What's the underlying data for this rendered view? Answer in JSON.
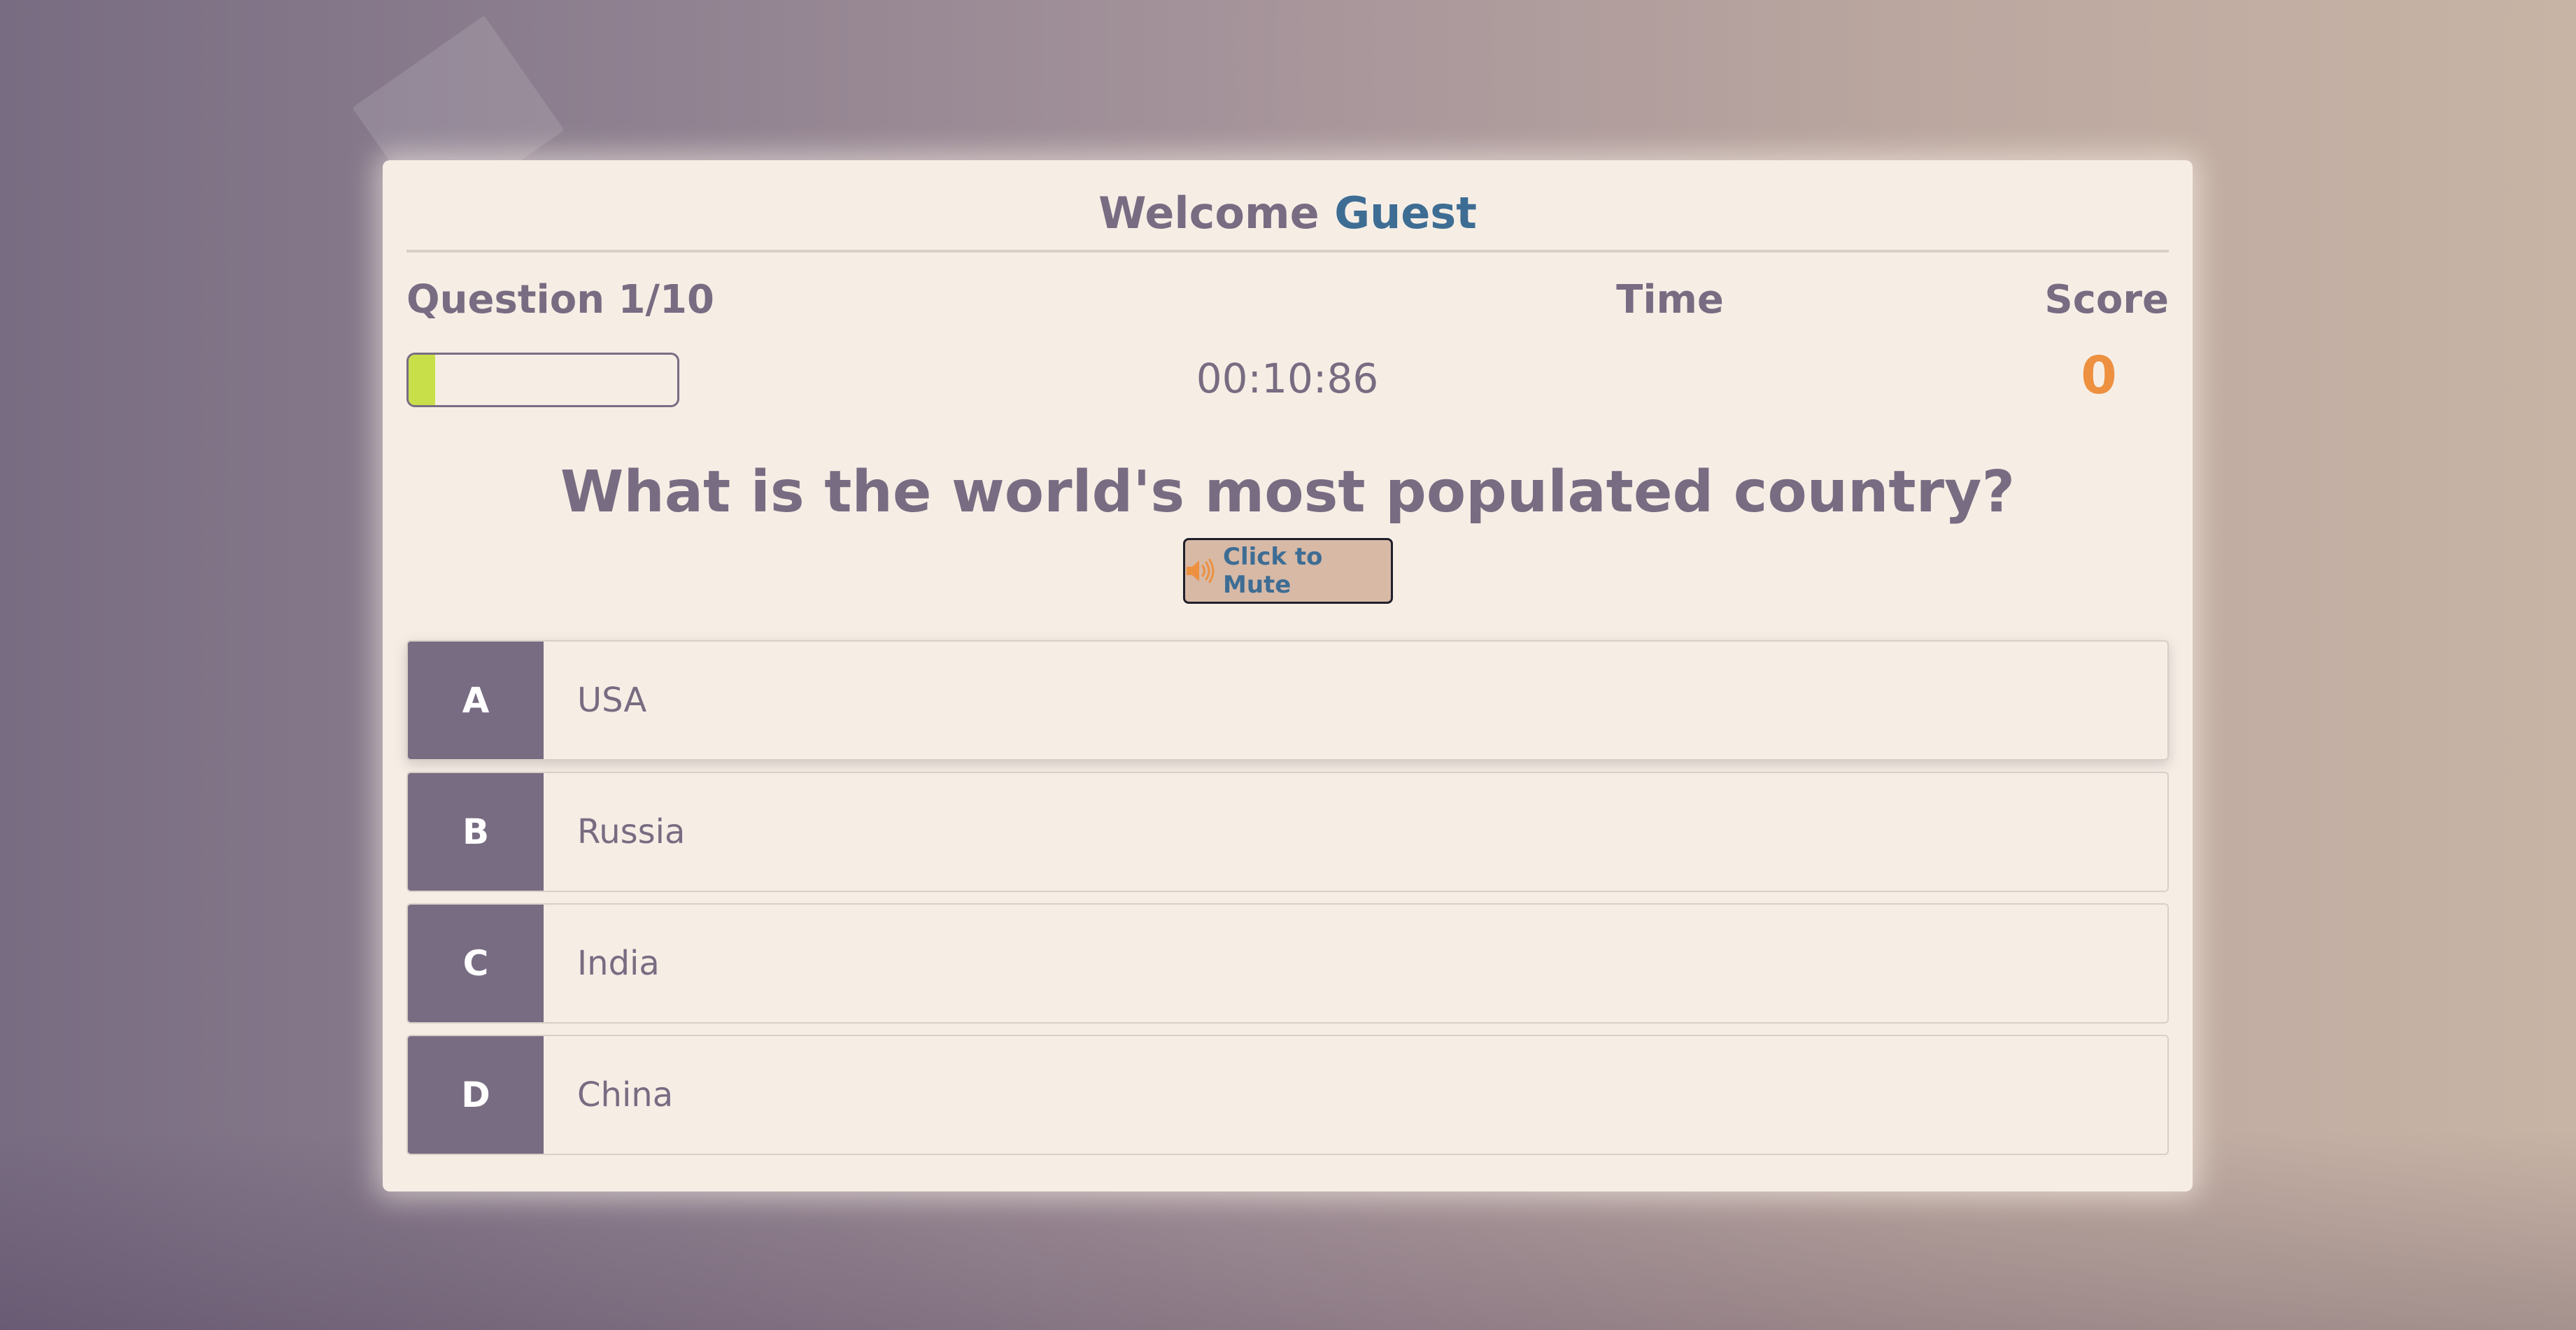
{
  "header": {
    "welcome_text": "Welcome",
    "username": "Guest"
  },
  "hud": {
    "question_label": "Question 1/10",
    "time_label": "Time",
    "score_label": "Score",
    "time_value": "00:10:86",
    "score_value": "0",
    "progress_fraction": 0.1
  },
  "question": {
    "text": "What is the world's most populated country?"
  },
  "mute_button": {
    "label": "Click to Mute",
    "icon": "speaker-icon"
  },
  "answers": [
    {
      "letter": "A",
      "text": "USA"
    },
    {
      "letter": "B",
      "text": "Russia"
    },
    {
      "letter": "C",
      "text": "India"
    },
    {
      "letter": "D",
      "text": "China"
    }
  ],
  "colors": {
    "primary": "#786c82",
    "accent_blue": "#3e6d94",
    "score_orange": "#ed9040",
    "progress_green": "#c9df4a",
    "card_bg": "#f6eee5"
  }
}
